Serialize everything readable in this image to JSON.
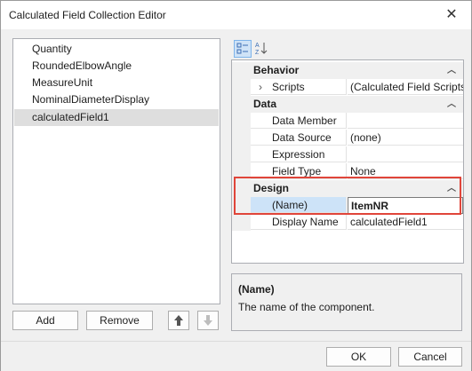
{
  "window": {
    "title": "Calculated Field Collection Editor"
  },
  "list": {
    "items": [
      {
        "label": "Quantity"
      },
      {
        "label": "RoundedElbowAngle"
      },
      {
        "label": "MeasureUnit"
      },
      {
        "label": "NominalDiameterDisplay"
      },
      {
        "label": "calculatedField1",
        "selected": true
      }
    ]
  },
  "left_buttons": {
    "add": "Add",
    "remove": "Remove",
    "up": "🡅",
    "down": "🡇"
  },
  "toolbar": {
    "categorized_icon": "categorized-icon",
    "alphabetical_icon": "sort-az-icon",
    "alpha_label": "A↓Z"
  },
  "property_grid": {
    "categories": {
      "behavior": "Behavior",
      "data": "Data",
      "design": "Design"
    },
    "rows": {
      "scripts": {
        "name": "Scripts",
        "value": "(Calculated Field Scripts)"
      },
      "data_member": {
        "name": "Data Member",
        "value": ""
      },
      "data_source": {
        "name": "Data Source",
        "value": "(none)"
      },
      "expression": {
        "name": "Expression",
        "value": ""
      },
      "field_type": {
        "name": "Field Type",
        "value": "None"
      },
      "name": {
        "name": "(Name)",
        "value": "ItemNR"
      },
      "display_name": {
        "name": "Display Name",
        "value": "calculatedField1"
      }
    }
  },
  "description": {
    "title": "(Name)",
    "text": "The name of the component."
  },
  "dialog_buttons": {
    "ok": "OK",
    "cancel": "Cancel"
  },
  "accent_colors": {
    "highlight": "#e0453a",
    "selection": "#cde3f8"
  }
}
